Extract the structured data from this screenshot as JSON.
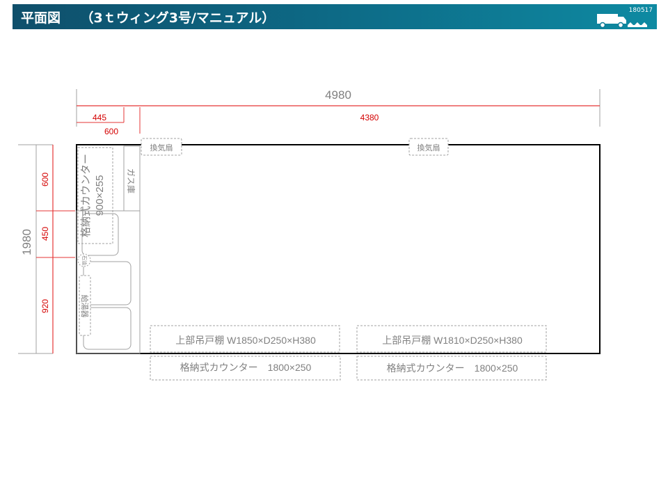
{
  "header": {
    "title": "平面図　　（3ｔウィング3号/マニュアル）",
    "doc_code": "180517",
    "icon": "truck-icon",
    "colors": {
      "bar_start": "#0f4f6b",
      "bar_end": "#0e8aa2",
      "text": "#ffffff"
    }
  },
  "dimensions": {
    "total_length": "4980",
    "front_segment": "445",
    "gas_storage_offset": "600",
    "main_span": "4380",
    "total_width": "1980",
    "side_1": "600",
    "side_2": "450",
    "side_3": "920"
  },
  "labels": {
    "vent_fan_left": "換気扇",
    "vent_fan_right": "換気扇",
    "side_counter": "格納式カウンター",
    "side_counter_size": "900×255",
    "gas_storage": "ガス庫",
    "kerosene": "石油",
    "water_heater": "給湯器",
    "upper_cabinet_left": "上部吊戸棚 W1850×D250×H380",
    "upper_cabinet_right": "上部吊戸棚 W1810×D250×H380",
    "counter_left": "格納式カウンター　1800×250",
    "counter_right": "格納式カウンター　1800×250"
  },
  "colors": {
    "dimension": "#e53535",
    "dim_text": "#d40000",
    "gray_text": "#808080",
    "outline": "#000000",
    "dashed": "#a0a0a0"
  }
}
